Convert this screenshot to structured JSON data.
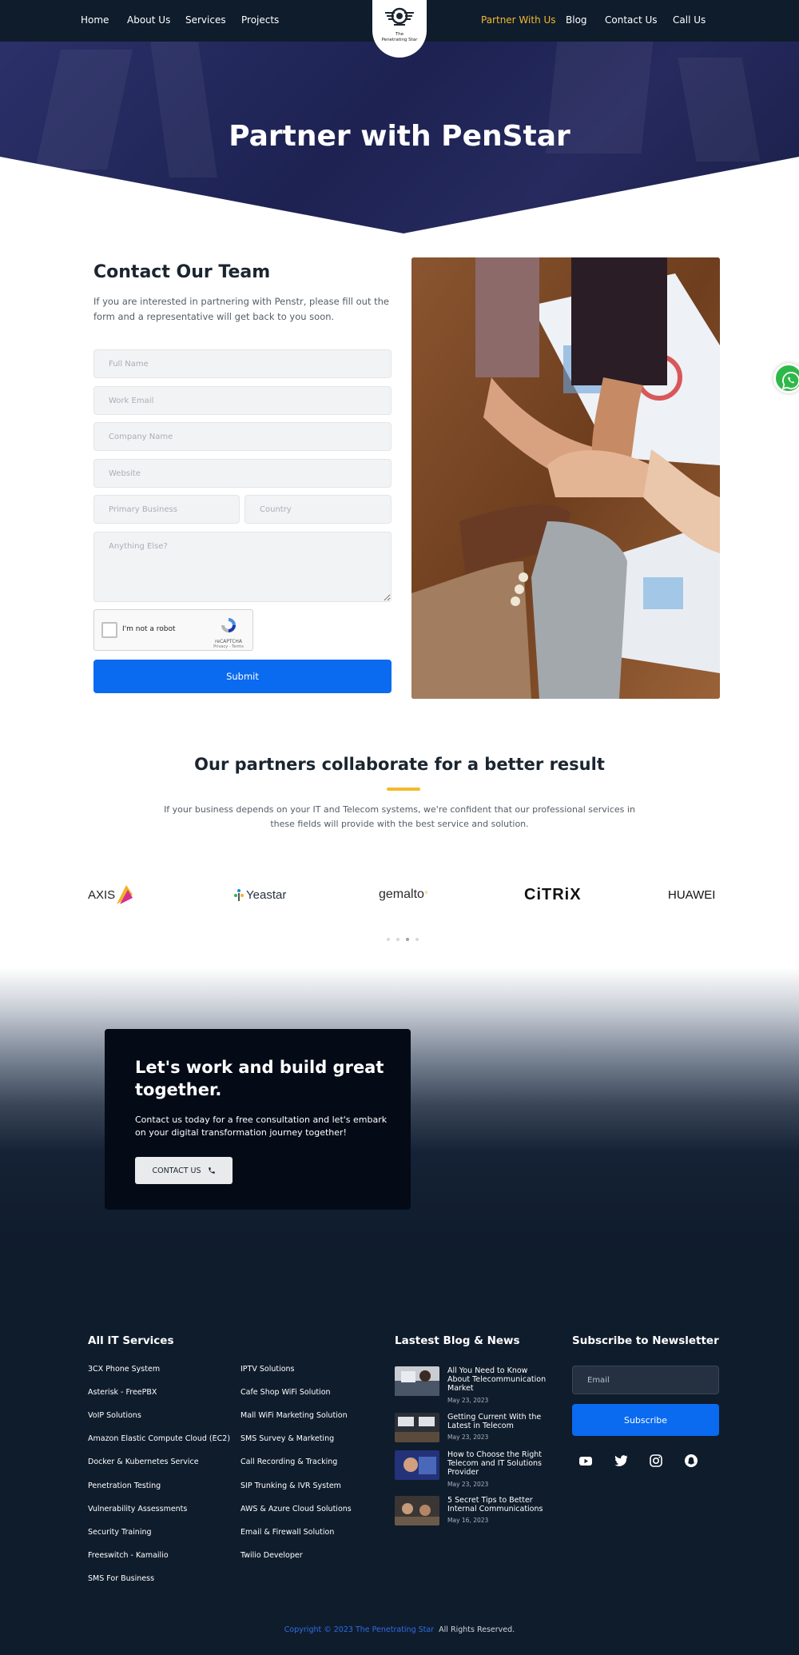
{
  "nav": {
    "left": [
      "Home",
      "About Us",
      "Services",
      "Projects"
    ],
    "right": [
      "Partner With Us",
      "Blog",
      "Contact Us",
      "Call Us"
    ],
    "active": "Partner With Us",
    "logo_text": [
      "The",
      "Penetrating Star"
    ]
  },
  "hero": {
    "title": "Partner with PenStar"
  },
  "contact": {
    "title": "Contact Our Team",
    "subtitle": "If you are interested in partnering with Penstr, please fill out the form and a representative will get back to you soon.",
    "fields": {
      "full_name": "Full Name",
      "work_email": "Work Email",
      "company_name": "Company Name",
      "website": "Website",
      "primary_business": "Primary Business",
      "country": "Country",
      "anything_else": "Anything Else?"
    },
    "recaptcha": {
      "label": "I'm not a robot",
      "brand": "reCAPTCHA",
      "terms": "Privacy - Terms"
    },
    "submit": "Submit"
  },
  "partners": {
    "title": "Our partners collaborate for a better result",
    "subtitle": "If your business depends on your IT and Telecom systems, we're confident that our professional services in these fields will provide with the best service and solution.",
    "logos": [
      "AXIS",
      "Yeastar",
      "gemalto",
      "CiTRiX",
      "HUAWEI"
    ]
  },
  "cta": {
    "title": "Let's work and build great together.",
    "text": "Contact us today for a free consultation and let's embark on your digital transformation journey together!",
    "button": "CONTACT US"
  },
  "footer": {
    "services_title": "All IT Services",
    "services_col1": [
      "3CX Phone System",
      "Asterisk - FreePBX",
      "VoIP Solutions",
      "Amazon Elastic Compute Cloud (EC2)",
      "Docker & Kubernetes Service",
      "Penetration Testing",
      "Vulnerability Assessments",
      "Security Training",
      "Freeswitch - Kamailio",
      "SMS For Business"
    ],
    "services_col2": [
      "IPTV Solutions",
      "Cafe Shop WiFi Solution",
      "Mall WiFi Marketing Solution",
      "SMS Survey & Marketing",
      "Call Recording & Tracking",
      "SIP Trunking & IVR System",
      "AWS & Azure Cloud Solutions",
      "Email & Firewall Solution",
      "Twilio Developer"
    ],
    "blog_title": "Lastest Blog & News",
    "blog": [
      {
        "title": "All You Need to Know About Telecommunication Market",
        "date": "May 23, 2023"
      },
      {
        "title": "Getting Current With the Latest in Telecom",
        "date": "May 23, 2023"
      },
      {
        "title": "How to Choose the Right Telecom and IT Solutions Provider",
        "date": "May 23, 2023"
      },
      {
        "title": "5 Secret Tips to Better Internal Communications",
        "date": "May 16, 2023"
      }
    ],
    "newsletter_title": "Subscribe to Newsletter",
    "email_placeholder": "Email",
    "subscribe": "Subscribe",
    "social": [
      "youtube-icon",
      "twitter-icon",
      "instagram-icon",
      "snapchat-icon"
    ],
    "copyright_brand": "Copyright © 2023 The Penetrating Star",
    "copyright_rest": "All Rights Reserved."
  },
  "colors": {
    "navy": "#0f1c2c",
    "accent": "#f5b92b",
    "primary": "#0a6af0",
    "whatsapp": "#2fb84a"
  }
}
